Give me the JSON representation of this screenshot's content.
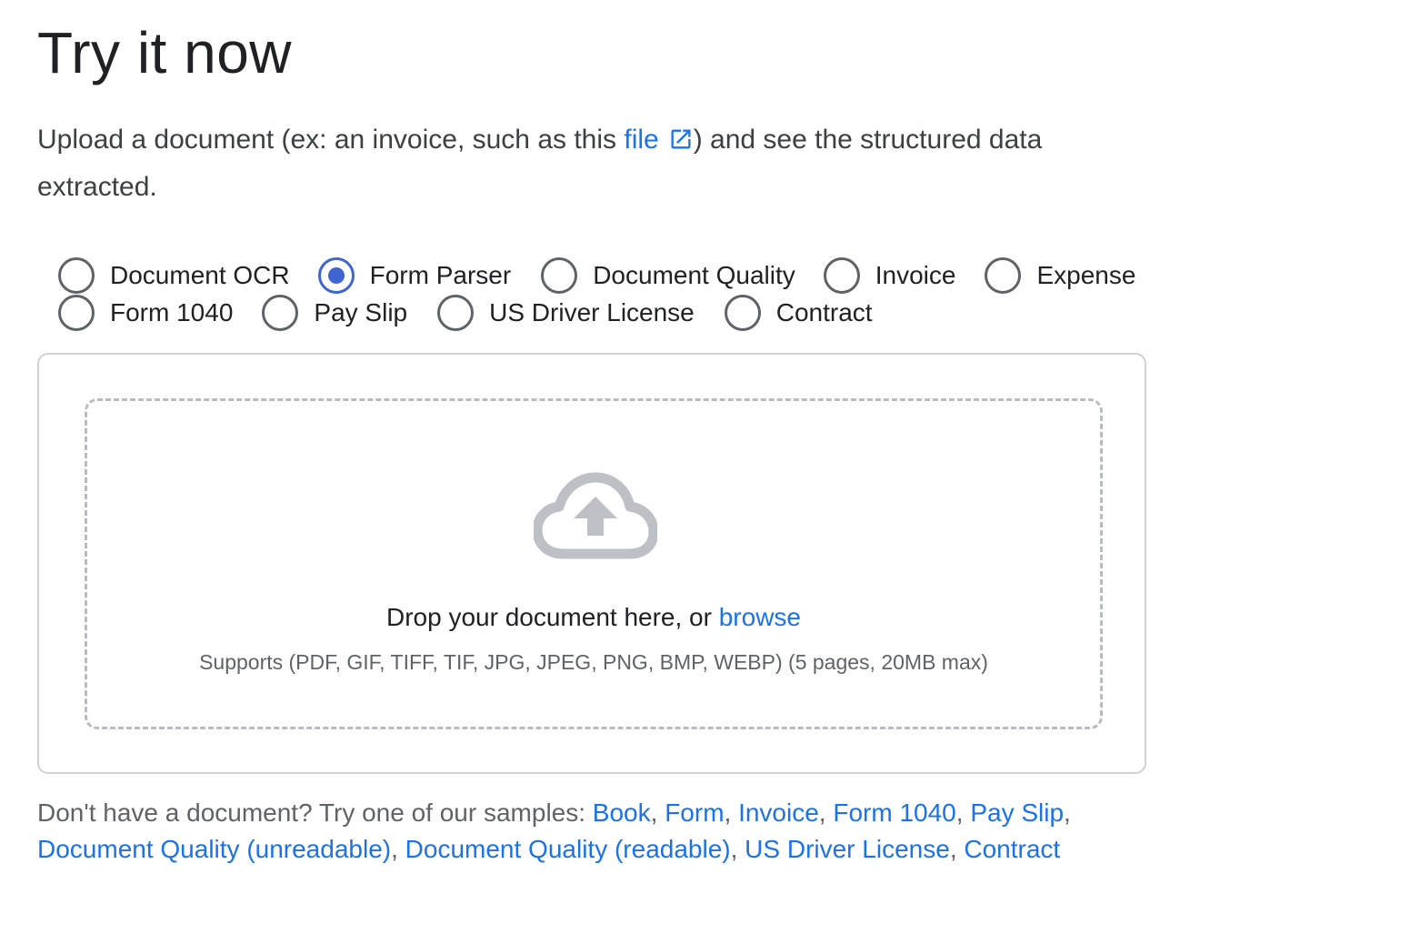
{
  "heading": "Try it now",
  "intro": {
    "text_before": "Upload a document (ex: an invoice, such as this ",
    "link_label": "file",
    "link_icon": "open-in-new-icon",
    "text_after": ") and see the structured data extracted."
  },
  "processors": [
    {
      "label": "Document OCR",
      "checked": false
    },
    {
      "label": "Form Parser",
      "checked": true
    },
    {
      "label": "Document Quality",
      "checked": false
    },
    {
      "label": "Invoice",
      "checked": false
    },
    {
      "label": "Expense",
      "checked": false
    },
    {
      "label": "Form 1040",
      "checked": false
    },
    {
      "label": "Pay Slip",
      "checked": false
    },
    {
      "label": "US Driver License",
      "checked": false
    },
    {
      "label": "Contract",
      "checked": false
    }
  ],
  "upload": {
    "icon": "cloud-upload-icon",
    "drop_text": "Drop your document here, or ",
    "browse_label": "browse",
    "supports": "Supports (PDF, GIF, TIFF, TIF, JPG, JPEG, PNG, BMP, WEBP) (5 pages, 20MB max)"
  },
  "samples": {
    "prompt": "Don't have a document? Try one of our samples: ",
    "links": [
      "Book",
      "Form",
      "Invoice",
      "Form 1040",
      "Pay Slip",
      "Document Quality (unreadable)",
      "Document Quality (readable)",
      "US Driver License",
      "Contract"
    ]
  },
  "colors": {
    "link": "#1a73e8",
    "radio_checked": "#3f66d0",
    "radio_unchecked": "#5f6368",
    "dashed_border": "#b8bcc1",
    "cloud_icon": "#bdc1c6"
  }
}
